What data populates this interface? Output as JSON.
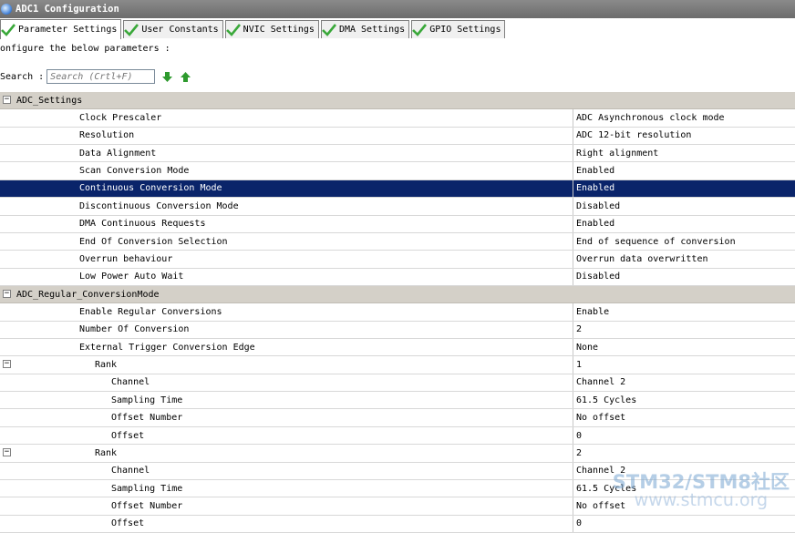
{
  "window": {
    "title": "ADC1 Configuration"
  },
  "tabs": [
    {
      "label": "Parameter Settings",
      "active": true
    },
    {
      "label": "User Constants",
      "active": false
    },
    {
      "label": "NVIC Settings",
      "active": false
    },
    {
      "label": "DMA Settings",
      "active": false
    },
    {
      "label": "GPIO Settings",
      "active": false
    }
  ],
  "configure_text": "onfigure the below parameters :",
  "search": {
    "label": "Search :",
    "placeholder": "Search (Crtl+F)"
  },
  "groups": {
    "adc_settings": {
      "label": "ADC_Settings",
      "rows": [
        {
          "name": "Clock Prescaler",
          "value": "ADC Asynchronous clock mode"
        },
        {
          "name": "Resolution",
          "value": "ADC 12-bit resolution"
        },
        {
          "name": "Data Alignment",
          "value": "Right alignment"
        },
        {
          "name": "Scan Conversion Mode",
          "value": "Enabled"
        },
        {
          "name": "Continuous Conversion Mode",
          "value": "Enabled",
          "selected": true
        },
        {
          "name": "Discontinuous Conversion Mode",
          "value": "Disabled"
        },
        {
          "name": "DMA Continuous Requests",
          "value": "Enabled"
        },
        {
          "name": "End Of Conversion Selection",
          "value": "End of sequence of conversion"
        },
        {
          "name": "Overrun behaviour",
          "value": "Overrun data overwritten"
        },
        {
          "name": "Low Power Auto Wait",
          "value": "Disabled"
        }
      ]
    },
    "adc_regular": {
      "label": "ADC_Regular_ConversionMode",
      "rows": [
        {
          "name": "Enable Regular Conversions",
          "value": "Enable"
        },
        {
          "name": "Number Of Conversion",
          "value": "2"
        },
        {
          "name": "External Trigger Conversion Edge",
          "value": "None"
        },
        {
          "name": "Rank",
          "value": "1"
        },
        {
          "name": "Channel",
          "value": "Channel 2"
        },
        {
          "name": "Sampling Time",
          "value": "61.5 Cycles"
        },
        {
          "name": "Offset Number",
          "value": "No offset"
        },
        {
          "name": "Offset",
          "value": "0"
        },
        {
          "name": "Rank",
          "value": "2"
        },
        {
          "name": "Channel",
          "value": "Channel 2"
        },
        {
          "name": "Sampling Time",
          "value": "61.5 Cycles"
        },
        {
          "name": "Offset Number",
          "value": "No offset"
        },
        {
          "name": "Offset",
          "value": "0"
        }
      ]
    }
  },
  "watermark": {
    "title": "STM32/STM8社区",
    "url": "www.stmcu.org"
  },
  "colors": {
    "selection": "#0a246a",
    "group_header": "#d4d0c8",
    "check": "#3aa83a",
    "arrow": "#2e9a2e"
  }
}
